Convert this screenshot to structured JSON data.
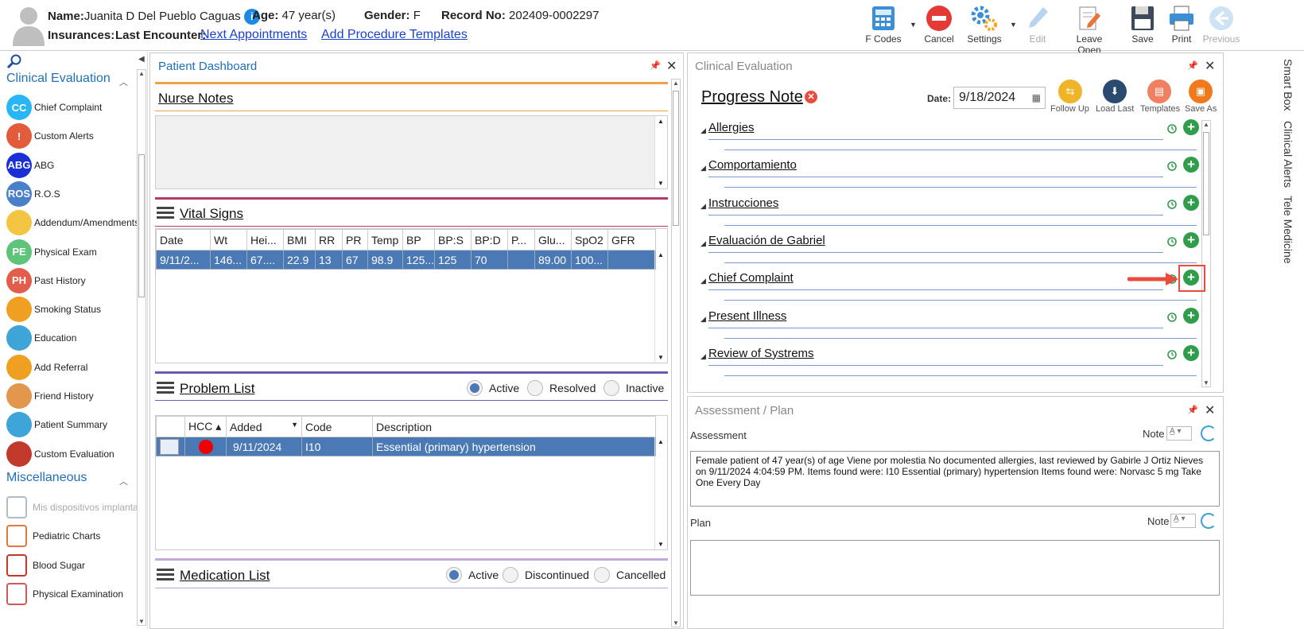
{
  "patient": {
    "name_label": "Name:",
    "name": "Juanita D Del Pueblo Caguas",
    "age_label": "Age:",
    "age": "47 year(s)",
    "gender_label": "Gender:",
    "gender": "F",
    "record_label": "Record No:",
    "record": "202409-0002297",
    "insurances_label": "Insurances:",
    "last_encounter_label": "Last Encounter:",
    "next_appointments_link": "Next Appointments",
    "add_procedure_link": "Add Procedure Templates"
  },
  "toolbar": {
    "fcodes": "F Codes",
    "cancel": "Cancel",
    "settings": "Settings",
    "edit": "Edit",
    "leave_open": "Leave Open",
    "save": "Save",
    "print": "Print",
    "previous": "Previous"
  },
  "sidebar": {
    "clinical_title": "Clinical Evaluation",
    "misc_title": "Miscellaneous",
    "items": [
      {
        "label": "Chief Complaint",
        "abbr": "CC",
        "color": "#29b6f6"
      },
      {
        "label": "Custom Alerts",
        "abbr": "!",
        "color": "#e25b3a"
      },
      {
        "label": "ABG",
        "abbr": "ABG",
        "color": "#1a2fd6"
      },
      {
        "label": "R.O.S",
        "abbr": "ROS",
        "color": "#4a7fc9"
      },
      {
        "label": "Addendum/Amendments",
        "abbr": "",
        "color": "#f4c542"
      },
      {
        "label": "Physical Exam",
        "abbr": "PE",
        "color": "#5ec47a"
      },
      {
        "label": "Past History",
        "abbr": "PH",
        "color": "#e35d4d"
      },
      {
        "label": "Smoking Status",
        "abbr": "",
        "color": "#f0a020"
      },
      {
        "label": "Education",
        "abbr": "",
        "color": "#3fa4d8"
      },
      {
        "label": "Add Referral",
        "abbr": "",
        "color": "#f0a020"
      },
      {
        "label": "Friend History",
        "abbr": "",
        "color": "#e3964d"
      },
      {
        "label": "Patient Summary",
        "abbr": "",
        "color": "#3fa4d8"
      },
      {
        "label": "Custom Evaluation",
        "abbr": "",
        "color": "#c0392b"
      }
    ],
    "misc_items": [
      {
        "label": "Mis dispositivos implanta",
        "muted": true
      },
      {
        "label": "Pediatric Charts",
        "muted": false
      },
      {
        "label": "Blood Sugar",
        "muted": false
      },
      {
        "label": "Physical Examination",
        "muted": false
      }
    ]
  },
  "dashboard": {
    "title": "Patient Dashboard",
    "nurse_notes": "Nurse Notes",
    "vital_signs": "Vital Signs",
    "vitals_columns": [
      "Date",
      "Wt",
      "Hei...",
      "BMI",
      "RR",
      "PR",
      "Temp",
      "BP",
      "BP:S",
      "BP:D",
      "P...",
      "Glu...",
      "SpO2",
      "GFR"
    ],
    "vitals_row": [
      "9/11/2...",
      "146...",
      "67....",
      "22.9",
      "13",
      "67",
      "98.9",
      "125...",
      "125",
      "70",
      "",
      "89.00",
      "100...",
      ""
    ],
    "problem_list": "Problem List",
    "problem_filters": [
      "Active",
      "Resolved",
      "Inactive"
    ],
    "problem_columns": [
      "HCC",
      "Added",
      "Code",
      "Description"
    ],
    "problem_row": {
      "added": "9/11/2024",
      "code": "I10",
      "description": "Essential (primary) hypertension"
    },
    "medication_list": "Medication List",
    "medication_filters": [
      "Active",
      "Discontinued",
      "Cancelled"
    ]
  },
  "clinical": {
    "panel_title": "Clinical Evaluation",
    "note_title": "Progress Note",
    "date_label": "Date:",
    "date_value": "9/18/2024",
    "actions": [
      "Follow Up",
      "Load Last",
      "Templates",
      "Save As"
    ],
    "sections": [
      "Allergies",
      "Comportamiento",
      "Instrucciones",
      "Evaluación de Gabriel",
      "Chief Complaint",
      "Present Illness",
      "Review of Systrems"
    ]
  },
  "assessment": {
    "panel_title": "Assessment / Plan",
    "assessment_label": "Assessment",
    "note_label": "Note",
    "assessment_text": "Female patient of 47 year(s) of age Viene por molestia     No documented allergies, last reviewed by Gabirle J Ortiz Nieves on 9/11/2024 4:04:59 PM.     Items found were:  I10 Essential (primary) hypertension  Items found were:  Norvasc 5 mg Take One Every Day",
    "plan_label": "Plan"
  },
  "side_tabs": [
    "Smart Box",
    "Clinical Alerts",
    "Tele Medicine"
  ]
}
